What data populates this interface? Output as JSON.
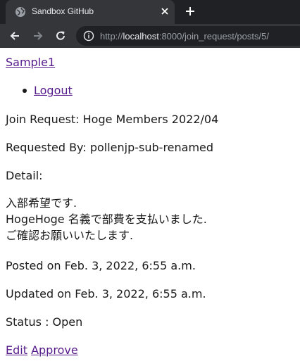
{
  "browser": {
    "tab_title": "Sandbox GitHub",
    "url_scheme": "http://",
    "url_host": "localhost",
    "url_rest": ":8000/join_request/posts/5/"
  },
  "page": {
    "site_link": "Sample1",
    "nav_items": [
      "Logout"
    ],
    "join_request": "Join Request: Hoge Members 2022/04",
    "requested_by": "Requested By: pollenjp-sub-renamed",
    "detail_label": "Detail:",
    "detail_lines": [
      "入部希望です.",
      "HogeHoge 名義で部費を支払いました.",
      "ご確認お願いいたします."
    ],
    "posted_on": "Posted on Feb. 3, 2022, 6:55 a.m.",
    "updated_on": "Updated on Feb. 3, 2022, 6:55 a.m.",
    "status": "Status : Open",
    "edit_link": "Edit",
    "approve_link": "Approve"
  },
  "colors": {
    "link_visited": "#551a8b",
    "chrome_dark": "#202124",
    "chrome_tab": "#35363a"
  }
}
